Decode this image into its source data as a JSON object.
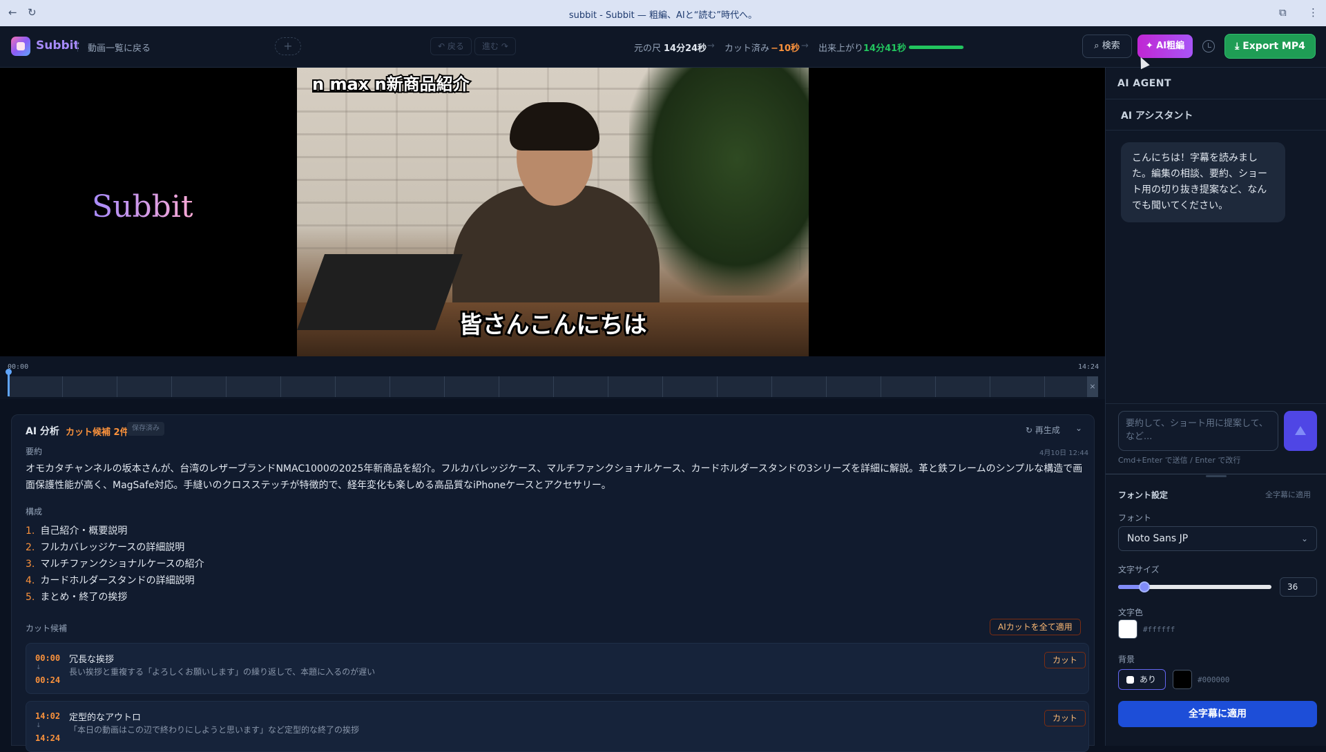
{
  "browser": {
    "title": "subbit - Subbit — 粗編、AIと“読む”時代へ。"
  },
  "topbar": {
    "brand": "Subbit",
    "back_link": "動画一覧に戻る",
    "undo": "↶ 戻る",
    "redo": "進む ↷",
    "stats": {
      "original_label": "元の尺",
      "original_value": "14分24秒",
      "cut_label": "カット済み",
      "cut_value": "−10秒",
      "result_label": "出来上がり",
      "result_value": "14分41秒",
      "progress": 0.99
    },
    "search_label": "検索",
    "ai_label": "AI粗編",
    "export_label": "Export MP4"
  },
  "video": {
    "side_logo": "Subbit",
    "caption_title": "n max n新商品紹介",
    "caption_sub": "皆さんこんにちは"
  },
  "timeline": {
    "start": "00:00",
    "end": "14:24",
    "position": 0.0
  },
  "analysis": {
    "title": "AI 分析",
    "cut_count": "カット候補 2件",
    "saved": "保存済み",
    "regen": "再生成",
    "summary_label": "要約",
    "date": "4月10日 12:44",
    "summary": "オモカタチャンネルの坂本さんが、台湾のレザーブランドNMAC1000の2025年新商品を紹介。フルカバレッジケース、マルチファンクショナルケース、カードホルダースタンドの3シリーズを詳細に解説。革と鉄フレームのシンプルな構造で画面保護性能が高く、MagSafe対応。手縫いのクロスステッチが特徴的で、経年変化も楽しめる高品質なiPhoneケースとアクセサリー。",
    "structure_label": "構成",
    "structure": [
      {
        "n": "1.",
        "text": "自己紹介・概要説明"
      },
      {
        "n": "2.",
        "text": "フルカバレッジケースの詳細説明"
      },
      {
        "n": "3.",
        "text": "マルチファンクショナルケースの紹介"
      },
      {
        "n": "4.",
        "text": "カードホルダースタンドの詳細説明"
      },
      {
        "n": "5.",
        "text": "まとめ・終了の挨拶"
      }
    ],
    "cuts_label": "カット候補",
    "apply_all": "AIカットを全て適用",
    "cuts": [
      {
        "start": "00:00",
        "end": "00:24",
        "title": "冗長な挨拶",
        "desc": "長い挨拶と重複する「よろしくお願いします」の繰り返しで、本題に入るのが遅い",
        "button": "カット"
      },
      {
        "start": "14:02",
        "end": "14:24",
        "title": "定型的なアウトロ",
        "desc": "「本日の動画はこの辺で終わりにしようと思います」など定型的な終了の挨拶",
        "button": "カット"
      }
    ]
  },
  "assistant": {
    "header": "AI AGENT",
    "subheader": "AI アシスタント",
    "message": "こんにちは！字幕を読みました。編集の相談、要約、ショート用の切り抜き提案など、なんでも聞いてください。",
    "input_placeholder": "要約して、ショート用に提案して、など...",
    "hint": "Cmd+Enter で送信 / Enter で改行"
  },
  "font_settings": {
    "title": "フォント設定",
    "apply_all_link": "全字幕に適用",
    "font_label": "フォント",
    "font_value": "Noto Sans JP",
    "size_label": "文字サイズ",
    "size_value": "36",
    "size_level": 0.17,
    "color_label": "文字色",
    "color_hex": "#ffffff",
    "bg_label": "背景",
    "bg_toggle": "あり",
    "bg_hex": "#000000",
    "apply_button": "全字幕に適用"
  },
  "colors": {
    "accent_orange": "#fb923c",
    "accent_purple": "#a855f7",
    "export_green": "#1f9d55",
    "apply_blue": "#1d4ed8"
  }
}
